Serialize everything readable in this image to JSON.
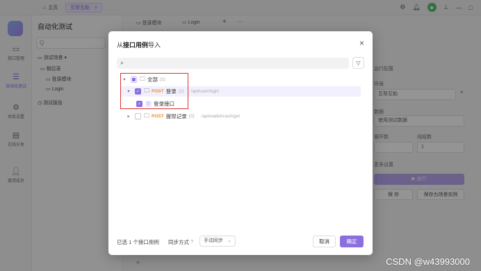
{
  "titlebar": {
    "home_label": "主页",
    "active_tab_label": "互帮互助",
    "close_glyph": "×"
  },
  "nav": {
    "items": [
      {
        "label": "接口管理",
        "icon": "api-icon"
      },
      {
        "label": "自动化测试",
        "icon": "automation-icon"
      },
      {
        "label": "项目设置",
        "icon": "settings-icon"
      },
      {
        "label": "在线分享",
        "icon": "share-icon"
      },
      {
        "label": "邀请成员",
        "icon": "invite-icon"
      }
    ]
  },
  "sidepanel": {
    "title": "自动化测试",
    "search_placeholder": "Q",
    "scenes_label": "测试场景",
    "root_label": "根目录",
    "item1": "登录模块",
    "item2": "Login",
    "report_label": "测试报告"
  },
  "content": {
    "tab1": "登录模块",
    "tab2": "Login",
    "plus": "+",
    "more": "···"
  },
  "rightpanel": {
    "title": "运行配置",
    "env_label": "环境",
    "env_value": "互帮互助",
    "data_label": "数据",
    "data_value": "使用测试数据",
    "loop_label": "循环数",
    "thread_label": "线程数",
    "thread_value": "1",
    "more_settings": "更多设置",
    "run_button": "▶ 运行",
    "save_button": "保 存",
    "save_as_button": "保存为场景实例"
  },
  "modal": {
    "title_prefix": "从",
    "title_bold": "接口用例",
    "title_suffix": "导入",
    "close": "×",
    "tree": {
      "root_label": "全部",
      "root_count": "(1)",
      "row2_method": "POST",
      "row2_label": "登录",
      "row2_count": "(1)",
      "row2_path": "/api/user/login",
      "row3_label": "登录接口",
      "row4_method": "POST",
      "row4_label": "提现记录",
      "row4_count": "(0)",
      "row4_path": "/api/wallet/cash/get"
    },
    "footer": {
      "selected_text": "已选 1 个接口用例",
      "sync_label": "同步方式",
      "help": "?",
      "sync_value": "手动同步",
      "cancel": "取消",
      "confirm": "确定"
    }
  },
  "collapse_glyph": "«",
  "watermark": "CSDN @w43993000",
  "colors": {
    "accent": "#8b6fe0",
    "method_post": "#f08b2b",
    "highlight_box": "#d9322e"
  }
}
